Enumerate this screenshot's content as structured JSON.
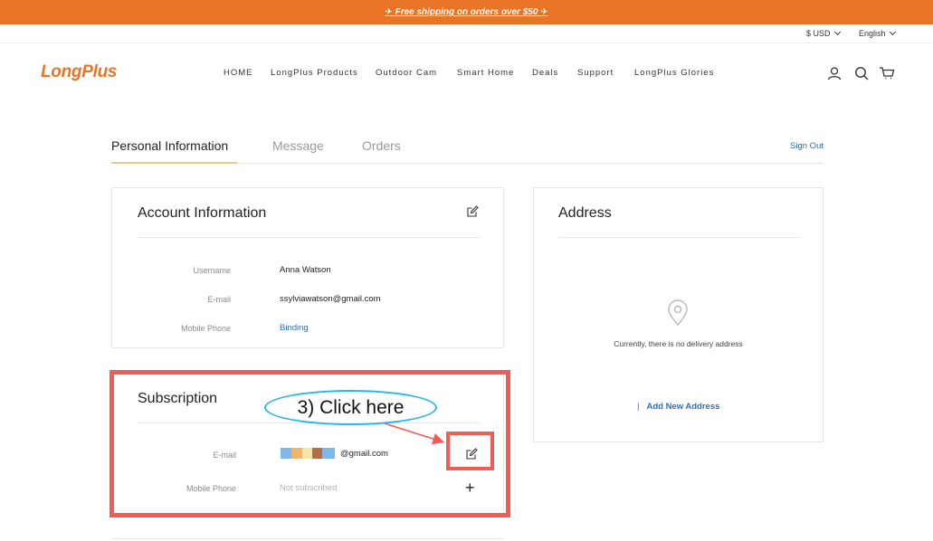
{
  "promo": {
    "text": "✈ Free shipping on orders over $50 ✈"
  },
  "utility": {
    "currency": "$ USD",
    "language": "English"
  },
  "brand": {
    "logo": "LongPlus"
  },
  "nav": {
    "items": [
      "HOME",
      "LongPlus Products",
      "Outdoor Cam",
      "Smart Home",
      "Deals",
      "Support",
      "LongPlus Glories"
    ]
  },
  "header_icons": [
    "user-icon",
    "search-icon",
    "cart-icon"
  ],
  "tabs": {
    "items": [
      "Personal Information",
      "Message",
      "Orders"
    ],
    "active": "Personal Information",
    "sign_out": "Sign Out"
  },
  "account": {
    "title": "Account Information",
    "rows": [
      {
        "label": "Username",
        "value": "Anna Watson"
      },
      {
        "label": "E-mail",
        "value": "ssylviawatson@gmail.com"
      },
      {
        "label": "Mobile Phone",
        "value": "Binding"
      }
    ]
  },
  "subscription": {
    "title": "Subscription",
    "email_label": "E-mail",
    "email_value": "@gmail.com",
    "phone_label": "Mobile Phone",
    "phone_value": "Not subscribed",
    "plus": "+"
  },
  "address": {
    "title": "Address",
    "empty_text": "Currently, there is no delivery address",
    "add_bar": "|",
    "add_label": "Add New Address"
  },
  "annotation": {
    "callout": "3) Click here",
    "highlight_color": "#f25c54",
    "callout_border_color": "#29b6e8"
  },
  "colors": {
    "accent": "#ea7425",
    "link": "#2c6fb3"
  }
}
